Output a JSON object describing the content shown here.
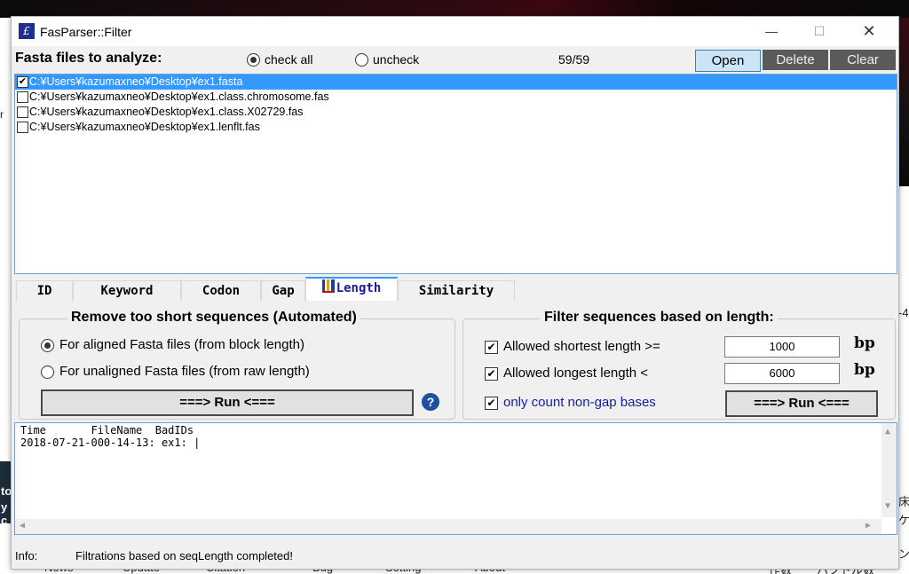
{
  "window": {
    "title": "FasParser::Filter",
    "icon": "app-logo-icon",
    "controls": {
      "minimize": "—",
      "maximize": "☐",
      "close": "✕"
    }
  },
  "header": {
    "label": "Fasta files to analyze:",
    "check_all": "check all",
    "uncheck": "uncheck",
    "count": "59/59",
    "open": "Open",
    "delete": "Delete",
    "clear": "Clear"
  },
  "files": [
    {
      "path": "C:¥Users¥kazumaxneo¥Desktop¥ex1.fasta",
      "checked": true,
      "selected": true
    },
    {
      "path": "C:¥Users¥kazumaxneo¥Desktop¥ex1.class.chromosome.fas",
      "checked": false,
      "selected": false
    },
    {
      "path": "C:¥Users¥kazumaxneo¥Desktop¥ex1.class.X02729.fas",
      "checked": false,
      "selected": false
    },
    {
      "path": "C:¥Users¥kazumaxneo¥Desktop¥ex1.lenflt.fas",
      "checked": false,
      "selected": false
    }
  ],
  "tabs": [
    {
      "label": "ID"
    },
    {
      "label": "Keyword"
    },
    {
      "label": "Codon"
    },
    {
      "label": "Gap"
    },
    {
      "label": "Length",
      "active": true
    },
    {
      "label": "Similarity"
    }
  ],
  "auto_group": {
    "title": "Remove too short sequences (Automated)",
    "opt_aligned": "For aligned Fasta files (from block length)",
    "opt_unaligned": "For unaligned Fasta files (from raw length)",
    "run": "===> Run <===",
    "help": "?"
  },
  "length_group": {
    "title": "Filter sequences based on length:",
    "shortest_label": "Allowed shortest length >=",
    "shortest_value": "1000",
    "longest_label": "Allowed longest length <",
    "longest_value": "6000",
    "unit": "bp",
    "nongap_label": "only count non-gap bases",
    "run": "===> Run <==="
  },
  "log": {
    "header": "Time       FileName  BadIDs",
    "line1": "2018-07-21-000-14-13: ex1: |"
  },
  "status": {
    "label": "Info:",
    "message": "Filtrations based on seqLength completed!"
  },
  "background": {
    "left_text": "r",
    "left_dark_1": "to",
    "left_dark_2": "y c",
    "right_glyphs": [
      "-4",
      "床",
      "ケ",
      "ン"
    ],
    "bottom_items": [
      "News",
      "Update",
      "Citation",
      "Bug",
      "Setting",
      "About",
      "作数",
      "ハツトル数"
    ]
  },
  "colors": {
    "selection": "#3399ff",
    "accent_button": "#cce4f7",
    "dark_button": "#5a5a5a",
    "link_text": "#1a1aa0"
  }
}
